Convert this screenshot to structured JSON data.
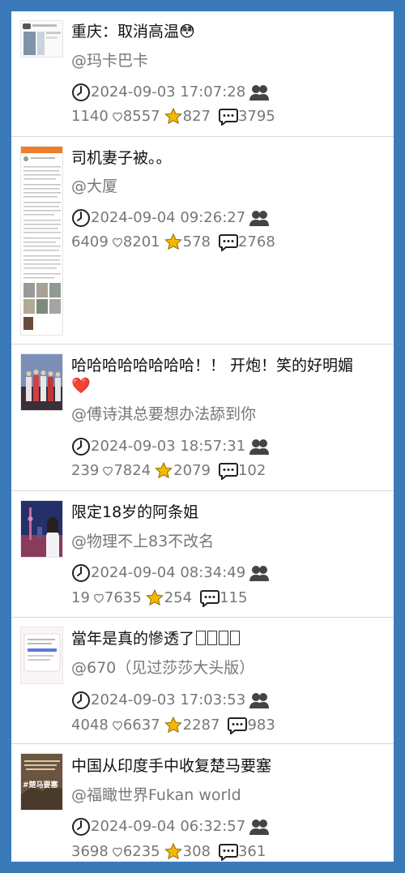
{
  "posts": [
    {
      "title": "重庆：取消高温",
      "emoji": "😳",
      "author": "@玛卡巴卡",
      "time": "2024-09-03 17:07:28",
      "views": "1140",
      "likes": "8557",
      "stars": "827",
      "comments": "3795"
    },
    {
      "title": "司机妻子被。。",
      "author": "@大厦",
      "time": "2024-09-04 09:26:27",
      "views": "6409",
      "likes": "8201",
      "stars": "578",
      "comments": "2768"
    },
    {
      "title": "哈哈哈哈哈哈哈哈！！ 开炮！笑的好明媚",
      "emoji": "❤️",
      "author": "@傅诗淇总要想办法舔到你",
      "time": "2024-09-03 18:57:31",
      "views": "239",
      "likes": "7824",
      "stars": "2079",
      "comments": "102"
    },
    {
      "title": "限定18岁的阿条姐",
      "author": "@物理不上83不改名",
      "time": "2024-09-04 08:34:49",
      "views": "19",
      "likes": "7635",
      "stars": "254",
      "comments": "115"
    },
    {
      "title": "當年是真的慘透了",
      "author": "@670（见过莎莎大头版）",
      "time": "2024-09-03 17:03:53",
      "views": "4048",
      "likes": "6637",
      "stars": "2287",
      "comments": "983"
    },
    {
      "title": "中国从印度手中收复楚马要塞",
      "author": "@福瞰世界Fukan world",
      "time": "2024-09-04 06:32:57",
      "views": "3698",
      "likes": "6235",
      "stars": "308",
      "comments": "361"
    }
  ],
  "thumb_text": {
    "p6": "#楚马要塞"
  },
  "colors": {
    "background": "#3a7ab8",
    "card": "#ffffff",
    "muted": "#777777",
    "star": "#f5b800",
    "heart": "#e02020"
  }
}
